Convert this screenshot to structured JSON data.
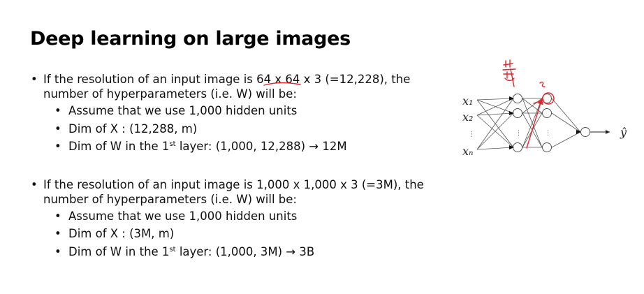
{
  "slide": {
    "title": "Deep learning on large images",
    "bullet1": {
      "line1": "If the resolution of an input image is 64 x 64 x 3 (=12,228), the",
      "line2": "number of hyperparameters (i.e. W) will be:",
      "sub": [
        {
          "text": "Assume that we use 1,000 hidden units"
        },
        {
          "text": "Dim of X : (12,288, m)"
        },
        {
          "pre": "Dim of W in the 1",
          "sup": "st",
          "post": " layer: (1,000, 12,288) → 12M"
        }
      ]
    },
    "bullet2": {
      "line1": "If the resolution of an input image is 1,000 x 1,000 x 3 (=3M), the",
      "line2": "number of hyperparameters (i.e. W) will be:",
      "sub": [
        {
          "text": "Assume that we use 1,000 hidden units"
        },
        {
          "text": "Dim of X : (3M, m)"
        },
        {
          "pre": "Dim of W in the 1",
          "sup": "st",
          "post": " layer: (1,000, 3M) → 3B"
        }
      ]
    },
    "bullet_glyph": "•"
  },
  "diagram": {
    "inputs": [
      "x₁",
      "x₂",
      "⋮",
      "xₙ"
    ],
    "output": "ŷ",
    "hidden_dots": "⋮"
  },
  "colors": {
    "annotation": "#e8202a",
    "network": "#555555"
  }
}
